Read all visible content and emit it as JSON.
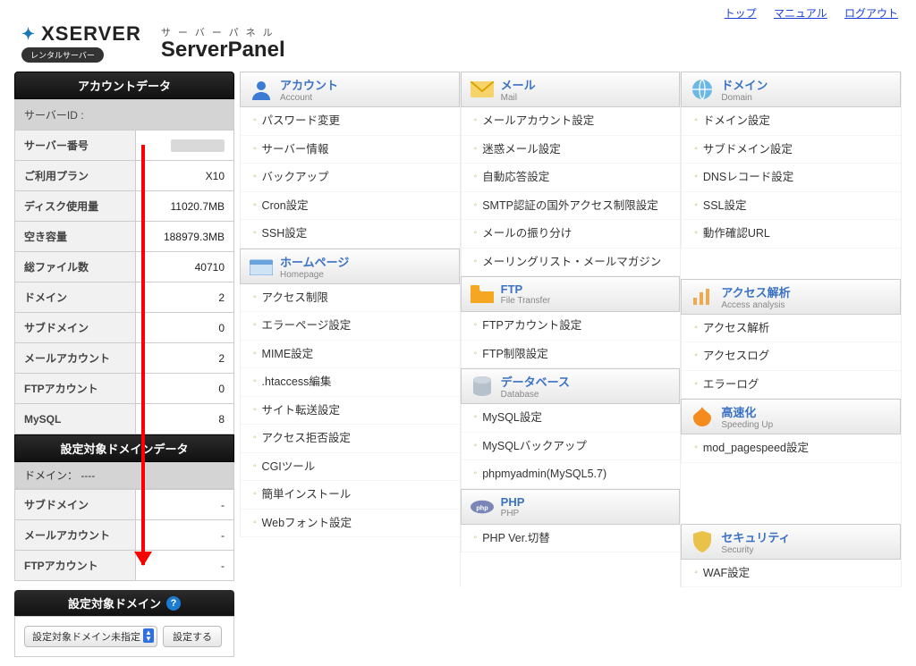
{
  "top_links": {
    "top": "トップ",
    "manual": "マニュアル",
    "logout": "ログアウト"
  },
  "logo": {
    "brand": "XSERVER",
    "badge": "レンタルサーバー"
  },
  "panel": {
    "kana": "サーバーパネル",
    "latin": "ServerPanel"
  },
  "sidebar": {
    "account_header": "アカウントデータ",
    "account_rows": [
      {
        "label": "サーバーID :",
        "value": ""
      },
      {
        "label": "サーバー番号",
        "value": ""
      },
      {
        "label": "ご利用プラン",
        "value": "X10"
      },
      {
        "label": "ディスク使用量",
        "value": "11020.7MB"
      },
      {
        "label": "空き容量",
        "value": "188979.3MB"
      },
      {
        "label": "総ファイル数",
        "value": "40710"
      },
      {
        "label": "ドメイン",
        "value": "2"
      },
      {
        "label": "サブドメイン",
        "value": "0"
      },
      {
        "label": "メールアカウント",
        "value": "2"
      },
      {
        "label": "FTPアカウント",
        "value": "0"
      },
      {
        "label": "MySQL",
        "value": "8"
      }
    ],
    "domain_data_header": "設定対象ドメインデータ",
    "domain_line": "ドメイン： ----",
    "domain_rows": [
      {
        "label": "サブドメイン",
        "value": "-"
      },
      {
        "label": "メールアカウント",
        "value": "-"
      },
      {
        "label": "FTPアカウント",
        "value": "-"
      }
    ],
    "target_domain_header": "設定対象ドメイン",
    "target_domain_select": "設定対象ドメイン未指定",
    "target_domain_button": "設定する"
  },
  "sections": {
    "account": {
      "jp": "アカウント",
      "en": "Account",
      "links": [
        "パスワード変更",
        "サーバー情報",
        "バックアップ",
        "Cron設定",
        "SSH設定"
      ]
    },
    "mail": {
      "jp": "メール",
      "en": "Mail",
      "links": [
        "メールアカウント設定",
        "迷惑メール設定",
        "自動応答設定",
        "SMTP認証の国外アクセス制限設定",
        "メールの振り分け",
        "メーリングリスト・メールマガジン"
      ]
    },
    "domain": {
      "jp": "ドメイン",
      "en": "Domain",
      "links": [
        "ドメイン設定",
        "サブドメイン設定",
        "DNSレコード設定",
        "SSL設定",
        "動作確認URL"
      ]
    },
    "homepage": {
      "jp": "ホームページ",
      "en": "Homepage",
      "links": [
        "アクセス制限",
        "エラーページ設定",
        "MIME設定",
        ".htaccess編集",
        "サイト転送設定",
        "アクセス拒否設定",
        "CGIツール",
        "簡単インストール",
        "Webフォント設定"
      ]
    },
    "ftp": {
      "jp": "FTP",
      "en": "File Transfer",
      "links": [
        "FTPアカウント設定",
        "FTP制限設定"
      ]
    },
    "access": {
      "jp": "アクセス解析",
      "en": "Access analysis",
      "links": [
        "アクセス解析",
        "アクセスログ",
        "エラーログ"
      ]
    },
    "database": {
      "jp": "データベース",
      "en": "Database",
      "links": [
        "MySQL設定",
        "MySQLバックアップ",
        "phpmyadmin(MySQL5.7)"
      ]
    },
    "speedup": {
      "jp": "高速化",
      "en": "Speeding Up",
      "links": [
        "mod_pagespeed設定"
      ]
    },
    "php": {
      "jp": "PHP",
      "en": "PHP",
      "links": [
        "PHP Ver.切替"
      ]
    },
    "security": {
      "jp": "セキュリティ",
      "en": "Security",
      "links": [
        "WAF設定"
      ]
    }
  }
}
